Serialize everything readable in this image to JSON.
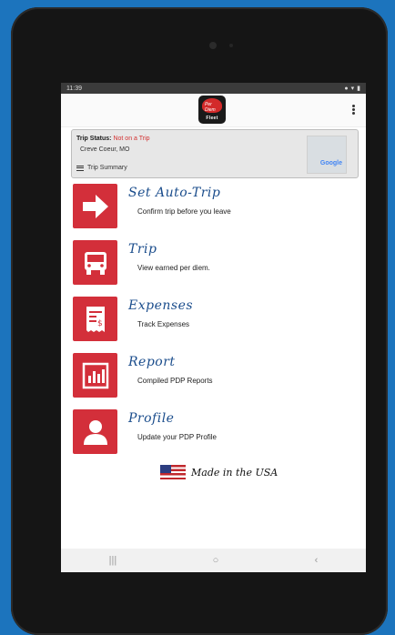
{
  "status_bar": {
    "time": "11:39"
  },
  "app": {
    "logo_word": "Fleet",
    "logo_badge": "Per Diem"
  },
  "trip_card": {
    "status_label": "Trip Status:",
    "status_value": "Not on a Trip",
    "location": "Creve Coeur, MO",
    "summary_label": "Trip Summary",
    "map_brand": "Google"
  },
  "menu": [
    {
      "title": "Set Auto-Trip",
      "subtitle": "Confirm trip before you leave",
      "icon": "arrow-right-icon"
    },
    {
      "title": "Trip",
      "subtitle": "View earned per diem.",
      "icon": "truck-icon"
    },
    {
      "title": "Expenses",
      "subtitle": "Track Expenses",
      "icon": "receipt-icon"
    },
    {
      "title": "Report",
      "subtitle": "Compiled PDP Reports",
      "icon": "bar-chart-icon"
    },
    {
      "title": "Profile",
      "subtitle": "Update your PDP Profile",
      "icon": "person-icon"
    }
  ],
  "footer": {
    "made_in": "Made in the USA"
  },
  "nav": {
    "recents": "|||",
    "home": "○",
    "back": "‹"
  },
  "colors": {
    "accent_red": "#d32f3a",
    "title_blue": "#1b4d8c",
    "device_blue": "#1c74bd"
  }
}
